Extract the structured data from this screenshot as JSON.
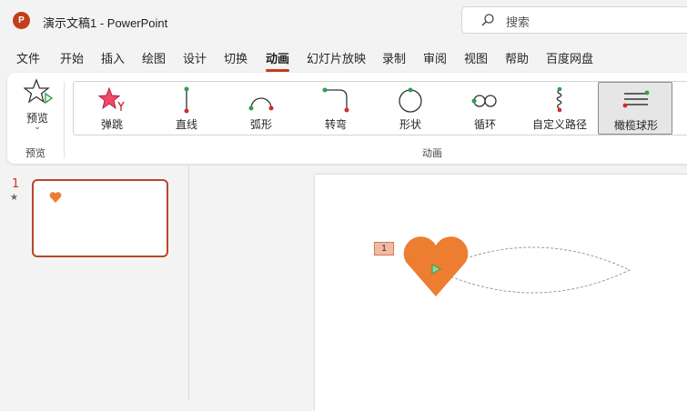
{
  "app": {
    "logo_letter": "P",
    "title": "演示文稿1  -  PowerPoint"
  },
  "search": {
    "placeholder": "搜索"
  },
  "menu": {
    "tabs": [
      {
        "label": "文件"
      },
      {
        "label": "开始"
      },
      {
        "label": "插入"
      },
      {
        "label": "绘图"
      },
      {
        "label": "设计"
      },
      {
        "label": "切换"
      },
      {
        "label": "动画",
        "active": true
      },
      {
        "label": "幻灯片放映"
      },
      {
        "label": "录制"
      },
      {
        "label": "审阅"
      },
      {
        "label": "视图"
      },
      {
        "label": "帮助"
      },
      {
        "label": "百度网盘"
      }
    ]
  },
  "ribbon": {
    "preview": {
      "button_label": "预览",
      "group_label": "预览"
    },
    "animation": {
      "group_label": "动画",
      "items": [
        {
          "label": "弹跳",
          "icon": "bounce-star-icon"
        },
        {
          "label": "直线",
          "icon": "line-path-icon"
        },
        {
          "label": "弧形",
          "icon": "arc-path-icon"
        },
        {
          "label": "转弯",
          "icon": "turn-path-icon"
        },
        {
          "label": "形状",
          "icon": "shape-path-icon"
        },
        {
          "label": "循环",
          "icon": "loop-path-icon"
        },
        {
          "label": "自定义路径",
          "icon": "custom-path-icon"
        },
        {
          "label": "橄榄球形",
          "icon": "football-path-icon",
          "selected": true
        }
      ]
    }
  },
  "slides": [
    {
      "number": "1",
      "has_animation_marker": "★"
    }
  ],
  "slide": {
    "animation_tag": "1",
    "heart_color": "#ed7d31"
  }
}
